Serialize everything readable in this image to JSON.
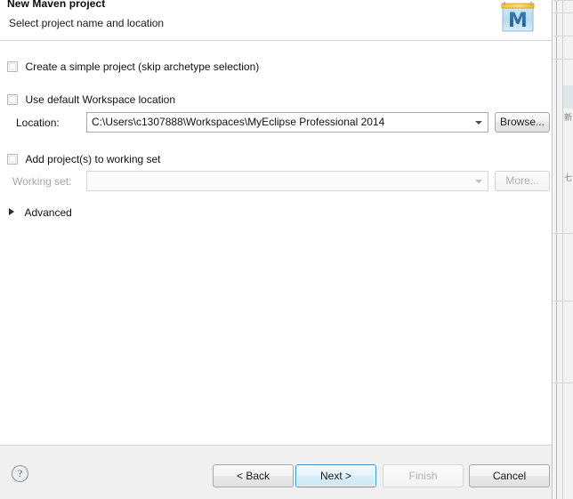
{
  "window": {
    "title": "New Maven project",
    "subtitle": "Select project name and location",
    "header_icon": "maven-m-icon"
  },
  "options": {
    "simple_project": {
      "label": "Create a simple project (skip archetype selection)",
      "checked": false
    },
    "default_workspace": {
      "label": "Use default Workspace location",
      "checked": false
    },
    "add_to_working_set": {
      "label": "Add project(s) to working set",
      "checked": false
    }
  },
  "location": {
    "label": "Location:",
    "value": "C:\\Users\\c1307888\\Workspaces\\MyEclipse Professional 2014",
    "placeholder": "",
    "browse_label": "Browse...",
    "dropdown_icon": "chevron-down-icon"
  },
  "working_set": {
    "label": "Working set:",
    "value": "",
    "placeholder": "",
    "more_label": "More...",
    "dropdown_icon": "chevron-down-icon",
    "disabled": true
  },
  "advanced": {
    "label": "Advanced",
    "expanded": false,
    "twisty_icon": "triangle-right-icon"
  },
  "footer": {
    "help_label": "?",
    "help_icon": "question-mark-icon",
    "buttons": {
      "back": "< Back",
      "next": "Next >",
      "finish": "Finish",
      "cancel": "Cancel"
    }
  },
  "colors": {
    "dialog_bg": "#ffffff",
    "footer_bg": "#f0f0f0",
    "default_button_border": "#3c9bd0",
    "disabled_text": "#b0b0b0",
    "text": "#111111"
  }
}
